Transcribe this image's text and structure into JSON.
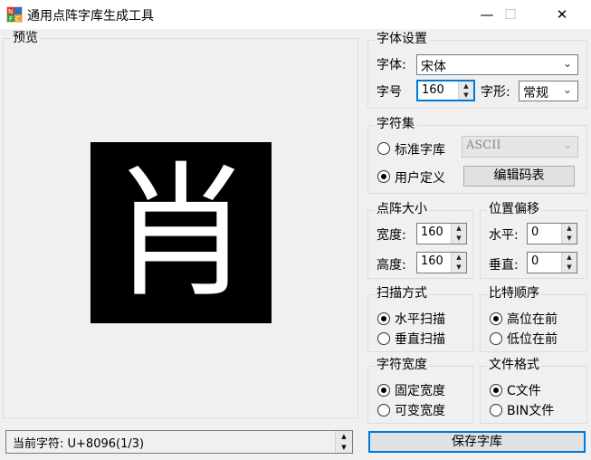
{
  "window": {
    "title": "通用点阵字库生成工具",
    "minimize": "—",
    "maximize": "☐",
    "close": "✕"
  },
  "preview": {
    "label": "预览",
    "glyph": "肖",
    "status": "当前字符: U+8096(1/3)"
  },
  "font_settings": {
    "label": "字体设置",
    "font_label": "字体:",
    "font_value": "宋体",
    "size_label": "字号",
    "size_value": "160",
    "style_label": "字形:",
    "style_value": "常规"
  },
  "charset": {
    "label": "字符集",
    "standard_label": "标准字库",
    "standard_value": "ASCII",
    "custom_label": "用户定义",
    "edit_button": "编辑码表"
  },
  "matrix_size": {
    "label": "点阵大小",
    "width_label": "宽度:",
    "width_value": "160",
    "height_label": "高度:",
    "height_value": "160"
  },
  "offset": {
    "label": "位置偏移",
    "h_label": "水平:",
    "h_value": "0",
    "v_label": "垂直:",
    "v_value": "0"
  },
  "scan": {
    "label": "扫描方式",
    "horizontal": "水平扫描",
    "vertical": "垂直扫描"
  },
  "bit_order": {
    "label": "比特顺序",
    "msb": "高位在前",
    "lsb": "低位在前"
  },
  "char_width": {
    "label": "字符宽度",
    "fixed": "固定宽度",
    "variable": "可变宽度"
  },
  "file_format": {
    "label": "文件格式",
    "c": "C文件",
    "bin": "BIN文件"
  },
  "save_button": "保存字库",
  "colors": {
    "focus_border": "#0078d7",
    "preview_bg": "#000000",
    "glyph": "#ffffff"
  }
}
